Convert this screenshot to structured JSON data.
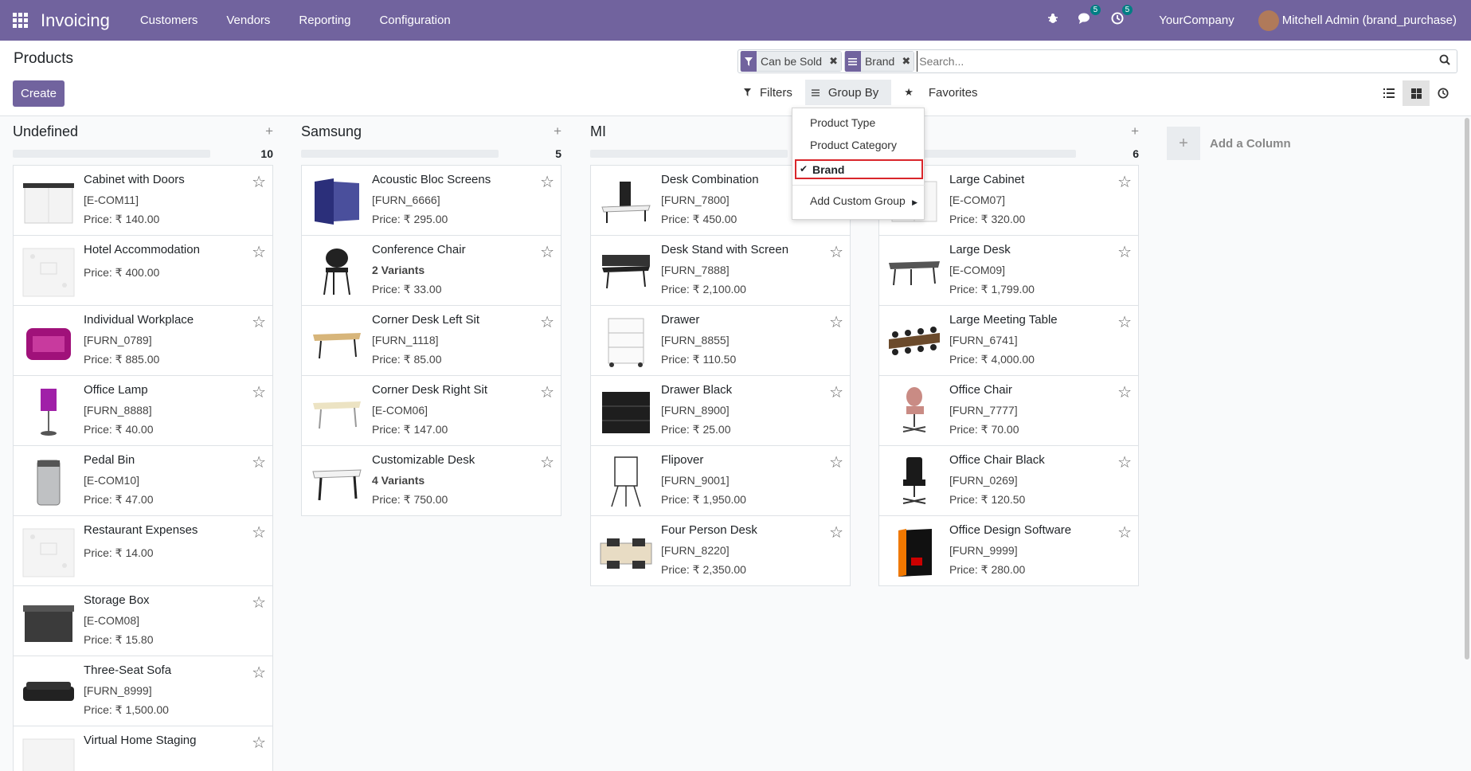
{
  "navbar": {
    "app_name": "Invoicing",
    "menu": [
      "Customers",
      "Vendors",
      "Reporting",
      "Configuration"
    ],
    "messages_badge": "5",
    "activities_badge": "5",
    "company": "YourCompany",
    "user": "Mitchell Admin (brand_purchase)",
    "accent": "#71639e"
  },
  "control_panel": {
    "title": "Products",
    "create_label": "Create",
    "facets": [
      {
        "icon": "filter-icon",
        "label": "Can be Sold"
      },
      {
        "icon": "groupby-icon",
        "label": "Brand"
      }
    ],
    "search_placeholder": "Search...",
    "filters_label": "Filters",
    "groupby_label": "Group By",
    "favorites_label": "Favorites"
  },
  "groupby_dropdown": {
    "items": [
      "Product Type",
      "Product Category",
      "Brand",
      "Add Custom Group"
    ],
    "selected": "Brand"
  },
  "kanban": {
    "add_column_label": "Add a Column",
    "columns": [
      {
        "title": "Undefined",
        "count": "10",
        "cards": [
          {
            "name": "Cabinet with Doors",
            "ref": "[E-COM11]",
            "price": "Price: ₹ 140.00"
          },
          {
            "name": "Hotel Accommodation",
            "ref": "",
            "price": "Price: ₹ 400.00"
          },
          {
            "name": "Individual Workplace",
            "ref": "[FURN_0789]",
            "price": "Price: ₹ 885.00"
          },
          {
            "name": "Office Lamp",
            "ref": "[FURN_8888]",
            "price": "Price: ₹ 40.00"
          },
          {
            "name": "Pedal Bin",
            "ref": "[E-COM10]",
            "price": "Price: ₹ 47.00"
          },
          {
            "name": "Restaurant Expenses",
            "ref": "",
            "price": "Price: ₹ 14.00"
          },
          {
            "name": "Storage Box",
            "ref": "[E-COM08]",
            "price": "Price: ₹ 15.80"
          },
          {
            "name": "Three-Seat Sofa",
            "ref": "[FURN_8999]",
            "price": "Price: ₹ 1,500.00"
          },
          {
            "name": "Virtual Home Staging",
            "ref": "",
            "price": ""
          }
        ]
      },
      {
        "title": "Samsung",
        "count": "5",
        "cards": [
          {
            "name": "Acoustic Bloc Screens",
            "ref": "[FURN_6666]",
            "price": "Price: ₹ 295.00"
          },
          {
            "name": "Conference Chair",
            "ref": "2 Variants",
            "price": "Price: ₹ 33.00",
            "variants": true
          },
          {
            "name": "Corner Desk Left Sit",
            "ref": "[FURN_1118]",
            "price": "Price: ₹ 85.00"
          },
          {
            "name": "Corner Desk Right Sit",
            "ref": "[E-COM06]",
            "price": "Price: ₹ 147.00"
          },
          {
            "name": "Customizable Desk",
            "ref": "4 Variants",
            "price": "Price: ₹ 750.00",
            "variants": true
          }
        ]
      },
      {
        "title": "MI",
        "count": "",
        "cards": [
          {
            "name": "Desk Combination",
            "ref": "[FURN_7800]",
            "price": "Price: ₹ 450.00"
          },
          {
            "name": "Desk Stand with Screen",
            "ref": "[FURN_7888]",
            "price": "Price: ₹ 2,100.00"
          },
          {
            "name": "Drawer",
            "ref": "[FURN_8855]",
            "price": "Price: ₹ 110.50"
          },
          {
            "name": "Drawer Black",
            "ref": "[FURN_8900]",
            "price": "Price: ₹ 25.00"
          },
          {
            "name": "Flipover",
            "ref": "[FURN_9001]",
            "price": "Price: ₹ 1,950.00"
          },
          {
            "name": "Four Person Desk",
            "ref": "[FURN_8220]",
            "price": "Price: ₹ 2,350.00"
          }
        ]
      },
      {
        "title": "",
        "count": "6",
        "cards": [
          {
            "name": "Large Cabinet",
            "ref": "[E-COM07]",
            "price": "Price: ₹ 320.00"
          },
          {
            "name": "Large Desk",
            "ref": "[E-COM09]",
            "price": "Price: ₹ 1,799.00"
          },
          {
            "name": "Large Meeting Table",
            "ref": "[FURN_6741]",
            "price": "Price: ₹ 4,000.00"
          },
          {
            "name": "Office Chair",
            "ref": "[FURN_7777]",
            "price": "Price: ₹ 70.00"
          },
          {
            "name": "Office Chair Black",
            "ref": "[FURN_0269]",
            "price": "Price: ₹ 120.50"
          },
          {
            "name": "Office Design Software",
            "ref": "[FURN_9999]",
            "price": "Price: ₹ 280.00"
          }
        ]
      }
    ]
  }
}
